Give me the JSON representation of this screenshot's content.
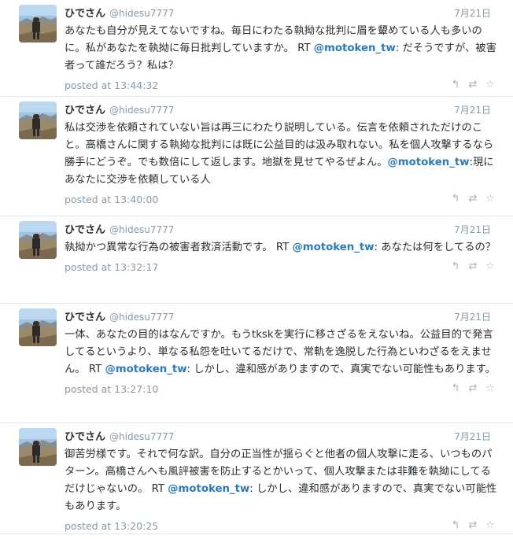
{
  "tweets": [
    {
      "name": "ひでさん",
      "handle": "@hidesu7777",
      "date": "7月21日",
      "text_parts": [
        {
          "t": "あなたも自分が見えてないですね。毎日にわたる執拗な批判に眉を顰めている人も多いのに。私があなたを執拗に毎日批判していますか。 RT "
        },
        {
          "t": "@motoken_tw",
          "mention": true
        },
        {
          "t": ": だそうですが、被害者って誰だろう？私は？"
        }
      ],
      "posted": "posted at 13:44:32"
    },
    {
      "name": "ひでさん",
      "handle": "@hidesu7777",
      "date": "7月21日",
      "text_parts": [
        {
          "t": "私は交渉を依頼されていない旨は再三にわたり説明している。伝言を依頼されただけのこと。高橋さんに関する執拗な批判には既に公益目的は汲み取れない。私を個人攻撃するなら勝手にどうぞ。でも数倍にして返します。地獄を見せてやるぜよん。"
        },
        {
          "t": "@motoken_tw",
          "mention": true
        },
        {
          "t": ":現にあなたに交渉を依頼している人"
        }
      ],
      "posted": "posted at 13:40:00"
    },
    {
      "name": "ひでさん",
      "handle": "@hidesu7777",
      "date": "7月21日",
      "text_parts": [
        {
          "t": "執拗かつ異常な行為の被害者救済活動です。 RT "
        },
        {
          "t": "@motoken_tw",
          "mention": true
        },
        {
          "t": ": あなたは何をしてるの？"
        }
      ],
      "posted": "posted at 13:32:17"
    },
    {
      "name": "ひでさん",
      "handle": "@hidesu7777",
      "date": "7月21日",
      "text_parts": [
        {
          "t": "一体、あなたの目的はなんですか。もうtkskを実行に移さざるをえないね。公益目的で発言してるというより、単なる私怨を吐いてるだけで、常軌を逸脱した行為といわざるをえません。 RT "
        },
        {
          "t": "@motoken_tw",
          "mention": true
        },
        {
          "t": ": しかし、違和感がありますので、真実でない可能性もあります。"
        }
      ],
      "posted": "posted at 13:27:10"
    },
    {
      "name": "ひでさん",
      "handle": "@hidesu7777",
      "date": "7月21日",
      "text_parts": [
        {
          "t": "御苦労様です。それで何な訳。自分の正当性が揺らぐと他者の個人攻撃に走る、いつものパターン。高橋さんへも風評被害を防止するとかいって、個人攻撃または非難を執拗にしてるだけじゃないの。 RT "
        },
        {
          "t": "@motoken_tw",
          "mention": true
        },
        {
          "t": ": しかし、違和感がありますので、真実でない可能性もあります。"
        }
      ],
      "posted": "posted at 13:20:25"
    }
  ],
  "icons": {
    "reply": "reply-icon",
    "retweet": "retweet-icon",
    "favorite": "star-icon"
  },
  "colors": {
    "link": "#2b7bb9",
    "muted": "#8899a6",
    "text": "#292f33"
  }
}
